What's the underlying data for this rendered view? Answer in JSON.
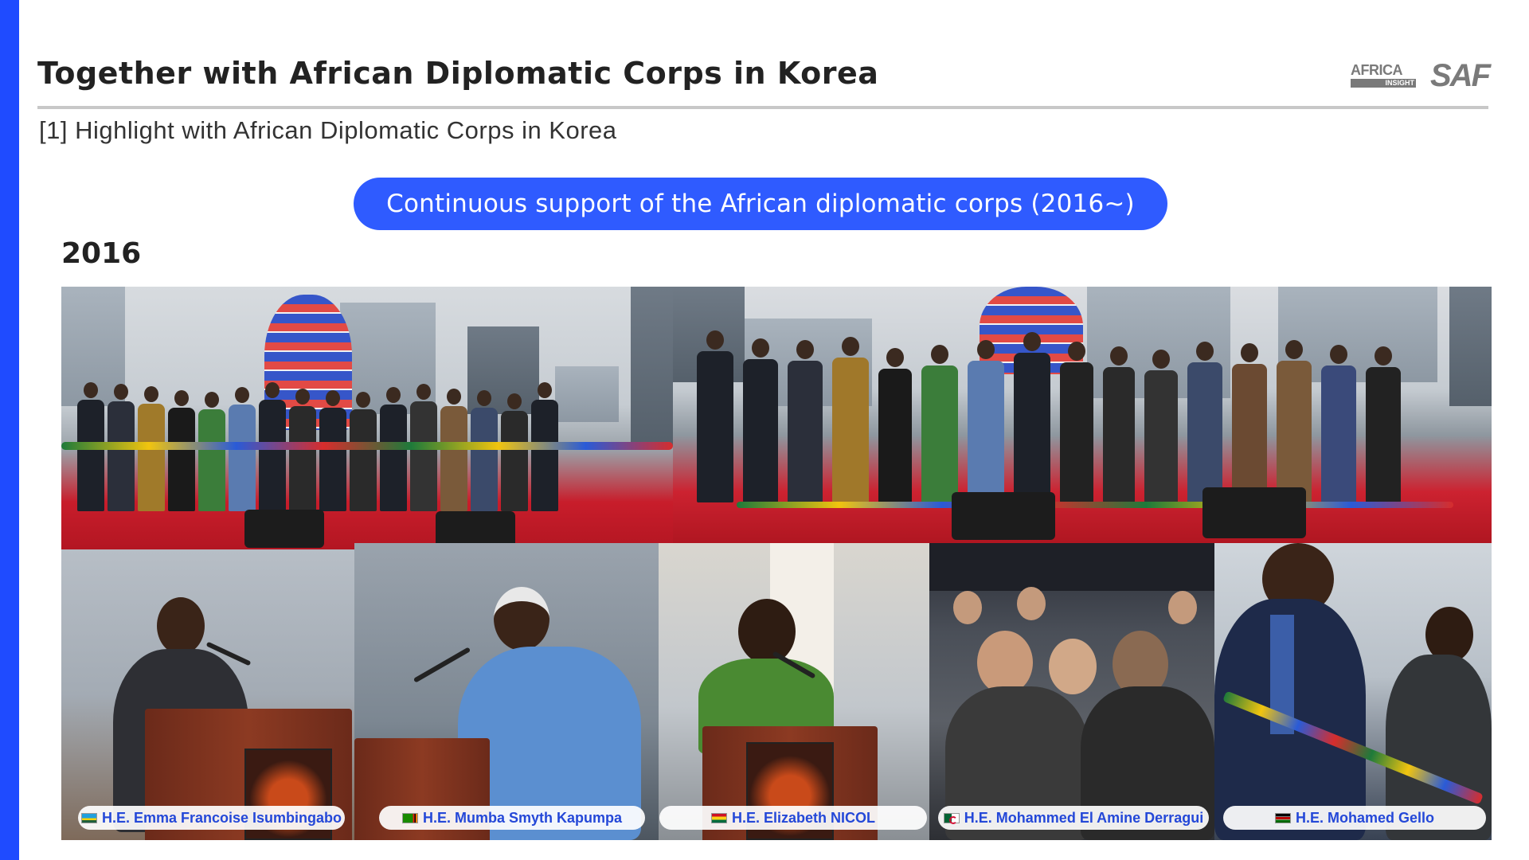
{
  "header": {
    "title": "Together with African Diplomatic Corps in Korea",
    "subtitle": "[1] Highlight with African Diplomatic Corps in Korea"
  },
  "logos": {
    "africa_insight": {
      "word": "AFRICA",
      "sub": "INSIGHT"
    },
    "saf": "SAF"
  },
  "banner": {
    "label": "Continuous support of the African diplomatic corps (2016~)"
  },
  "section": {
    "year": "2016"
  },
  "photos": {
    "top": [
      {
        "name": "ribbon-cutting-ceremony"
      },
      {
        "name": "group-photo-on-stage"
      }
    ],
    "captions": [
      {
        "flag": "rwanda-flag-icon",
        "text": "H.E. Emma Francoise Isumbingabo"
      },
      {
        "flag": "zambia-flag-icon",
        "text": "H.E. Mumba Smyth Kapumpa"
      },
      {
        "flag": "ghana-flag-icon",
        "text": "H.E. Elizabeth NICOL"
      },
      {
        "flag": "algeria-flag-icon",
        "text": "H.E. Mohammed El Amine Derragui"
      },
      {
        "flag": "kenya-flag-icon",
        "text": "H.E. Mohamed Gello"
      }
    ]
  },
  "colors": {
    "accent": "#2f5bff",
    "left_bar": "#1f4bff",
    "caption_text": "#2448d8"
  }
}
